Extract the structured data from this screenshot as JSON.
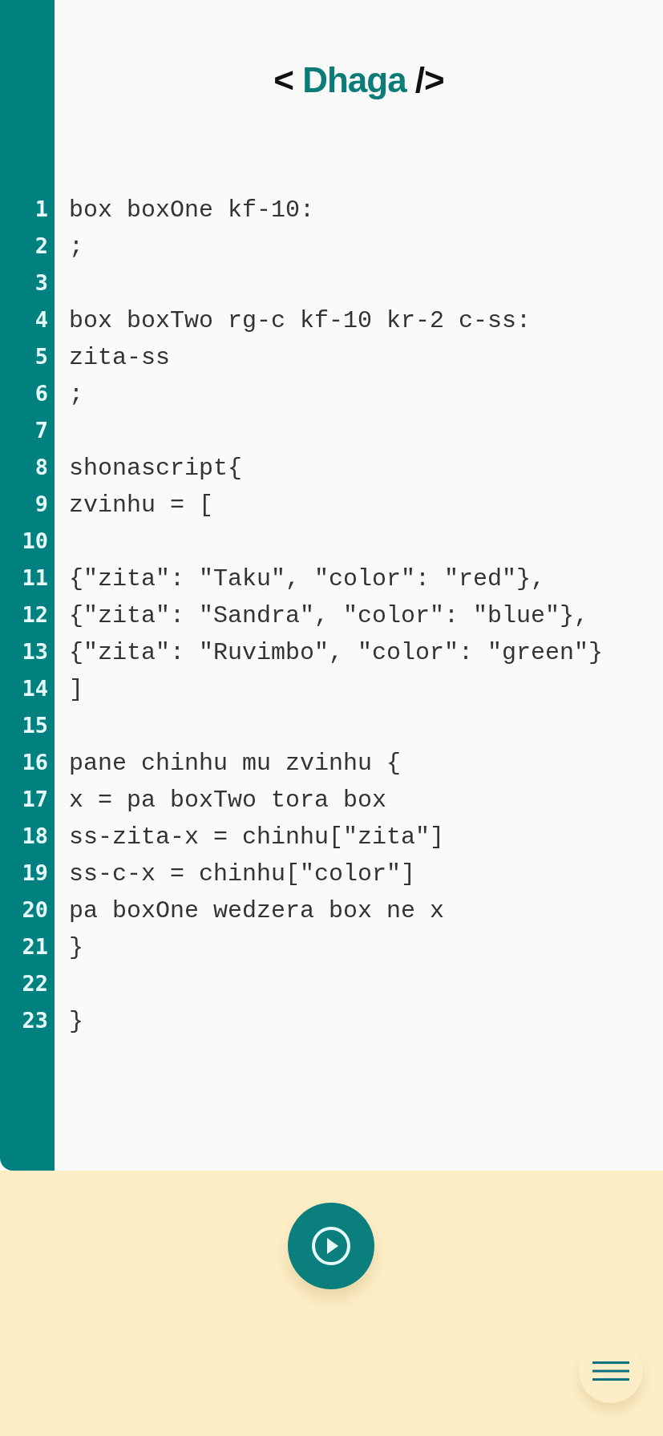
{
  "header": {
    "title_open": "<",
    "title_name": "Dhaga",
    "title_close": "/>"
  },
  "editor": {
    "lines": [
      {
        "number": "1",
        "text": "box boxOne kf-10:"
      },
      {
        "number": "2",
        "text": ";"
      },
      {
        "number": "3"
      },
      {
        "number": "4",
        "text": "box boxTwo rg-c kf-10 kr-2 c-ss:"
      },
      {
        "number": "5",
        "text": "zita-ss"
      },
      {
        "number": "6",
        "text": ";"
      },
      {
        "number": "7"
      },
      {
        "number": "8",
        "text": "shonascript{"
      },
      {
        "number": "9",
        "text": "zvinhu = ["
      },
      {
        "number": "10"
      },
      {
        "number": "11",
        "text": "{\"zita\": \"Taku\", \"color\": \"red\"},"
      },
      {
        "number": "12",
        "text": "{\"zita\": \"Sandra\", \"color\": \"blue\"},"
      },
      {
        "number": "13",
        "text": "{\"zita\": \"Ruvimbo\", \"color\": \"green\"}"
      },
      {
        "number": "14",
        "text": "]"
      },
      {
        "number": "15"
      },
      {
        "number": "16",
        "text": "pane chinhu mu zvinhu {"
      },
      {
        "number": "17",
        "text": "x = pa boxTwo tora box"
      },
      {
        "number": "18",
        "text": "ss-zita-x = chinhu[\"zita\"]"
      },
      {
        "number": "19",
        "text": "ss-c-x = chinhu[\"color\"]"
      },
      {
        "number": "20",
        "text": "pa boxOne wedzera box ne x"
      },
      {
        "number": "21",
        "text": "}"
      },
      {
        "number": "22"
      },
      {
        "number": "23",
        "text": "}"
      }
    ]
  }
}
